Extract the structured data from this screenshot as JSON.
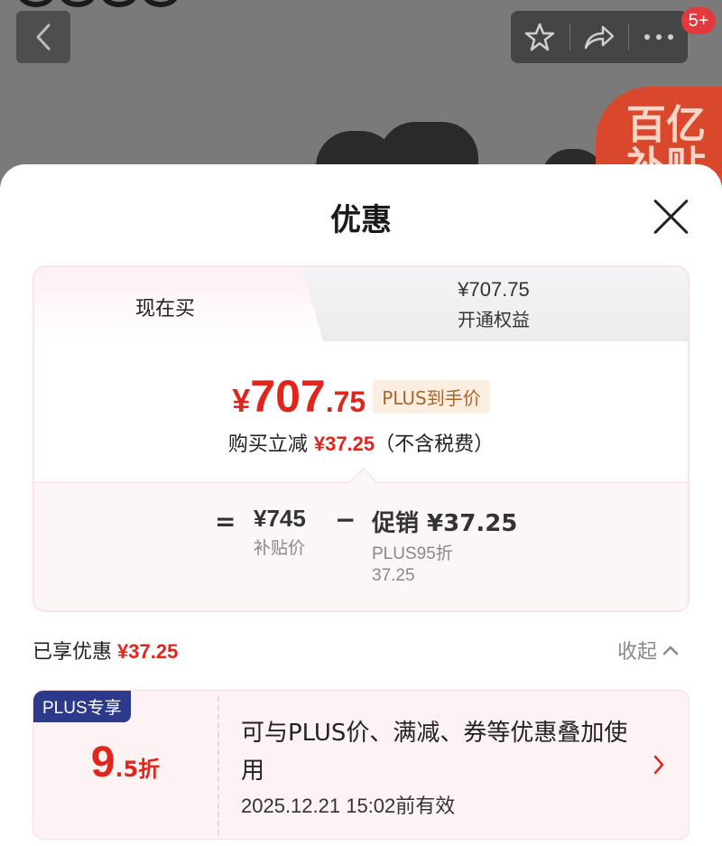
{
  "background": {
    "cart_badge": "5+",
    "subsidy_banner": "百亿\n补贴"
  },
  "sheet": {
    "title": "优惠"
  },
  "tabs": {
    "active_label": "现在买",
    "other_price": "¥707.75",
    "other_label": "开通权益"
  },
  "price": {
    "yen": "¥",
    "int": "707",
    "dec": ".75",
    "tag": "PLUS到手价",
    "reduce_prefix": "购买立减",
    "reduce_amount": "¥37.25",
    "reduce_suffix": "（不含税费）"
  },
  "breakdown": {
    "eq": "=",
    "base_value": "¥745",
    "base_label": "补贴价",
    "minus": "−",
    "promo_value": "促销 ¥37.25",
    "promo_detail_1": "PLUS95折",
    "promo_detail_2": "37.25"
  },
  "enjoyed": {
    "label": "已享优惠",
    "amount": "¥37.25",
    "collapse_label": "收起"
  },
  "coupon": {
    "tag": "PLUS专享",
    "discount_big": "9",
    "discount_small": ".5折",
    "description": "可与PLUS价、满减、券等优惠叠加使用",
    "valid_until": "2025.12.21 15:02前有效"
  },
  "colors": {
    "accent_red": "#e1251b",
    "plus_blue": "#2d3a8c",
    "tag_gold": "#a8672d"
  }
}
